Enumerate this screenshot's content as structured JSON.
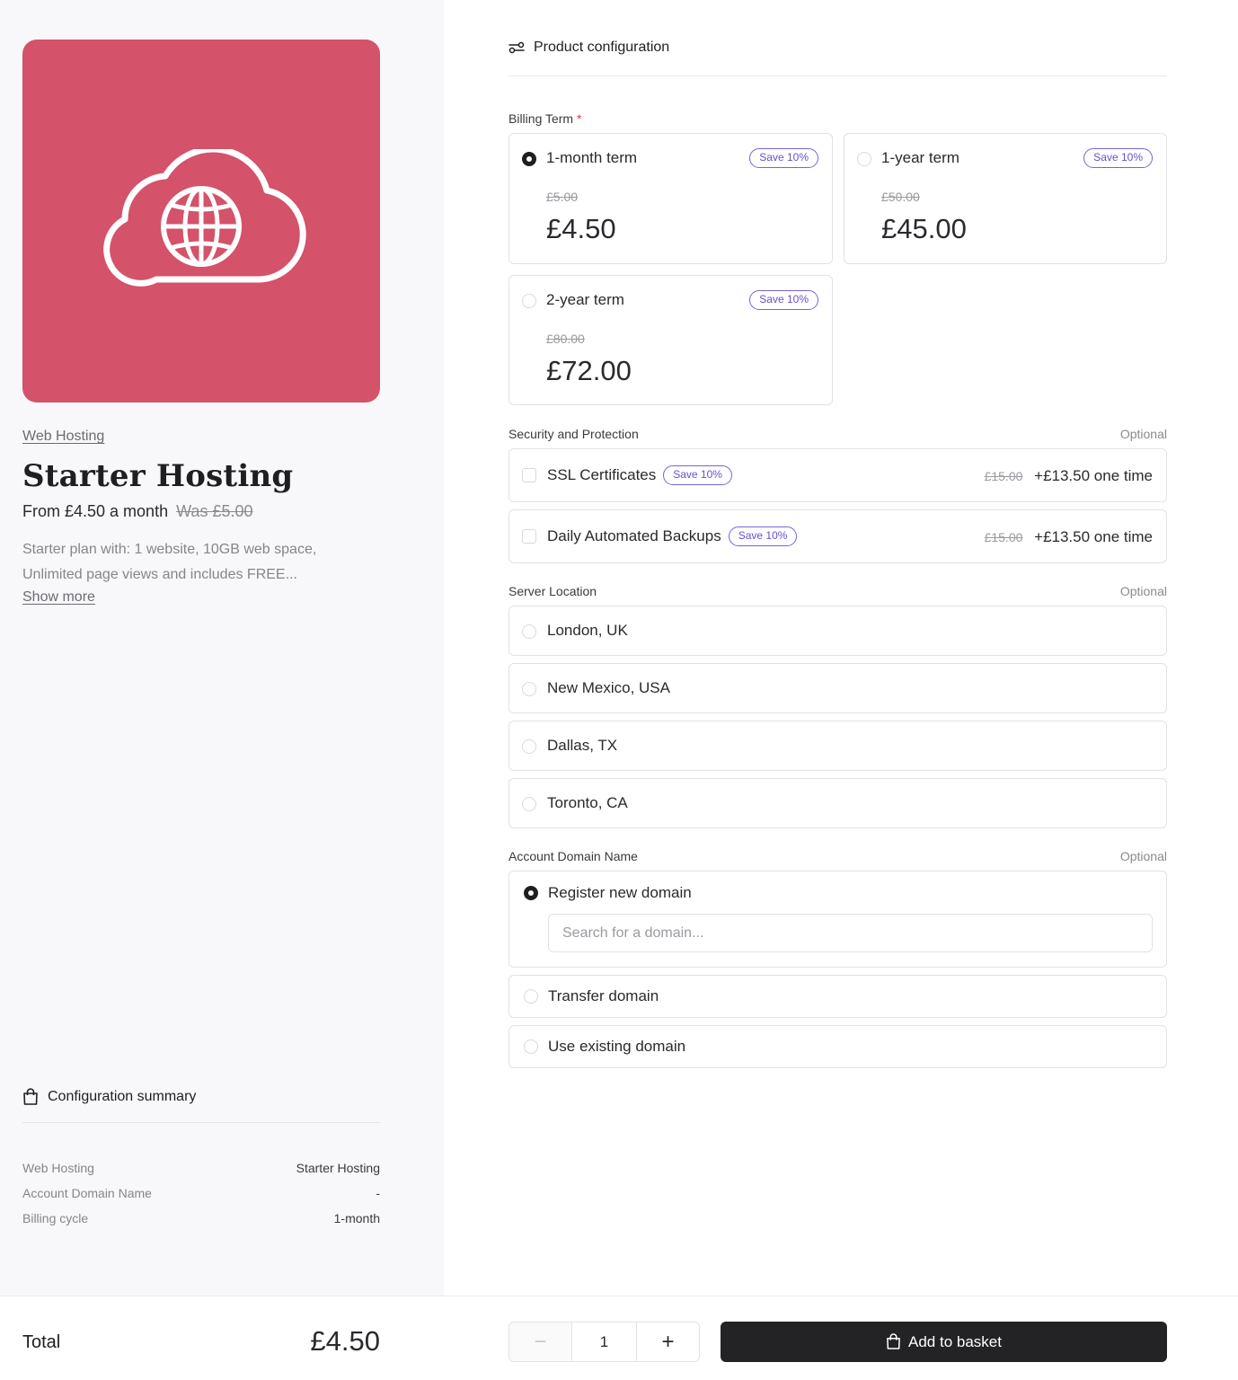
{
  "product": {
    "category": "Web Hosting",
    "title": "Starter Hosting",
    "from_text": "From £4.50 a month",
    "was_text": "Was £5.00",
    "description": "Starter plan with: 1 website, 10GB web space, Unlimited page views and includes FREE...",
    "show_more": "Show more",
    "hero_color": "#d4526a",
    "hero_icon": "cloud-globe-icon"
  },
  "summary": {
    "title": "Configuration summary",
    "rows": [
      {
        "key": "Web Hosting",
        "value": "Starter Hosting"
      },
      {
        "key": "Account Domain Name",
        "value": "-"
      },
      {
        "key": "Billing cycle",
        "value": "1-month"
      }
    ]
  },
  "config": {
    "title": "Product configuration",
    "billing": {
      "label": "Billing Term",
      "required_mark": "*",
      "terms": [
        {
          "name": "1-month term",
          "badge": "Save 10%",
          "old": "£5.00",
          "price": "£4.50",
          "selected": true
        },
        {
          "name": "1-year term",
          "badge": "Save 10%",
          "old": "£50.00",
          "price": "£45.00",
          "selected": false
        },
        {
          "name": "2-year term",
          "badge": "Save 10%",
          "old": "£80.00",
          "price": "£72.00",
          "selected": false
        }
      ]
    },
    "security": {
      "label": "Security and Protection",
      "optional": "Optional",
      "items": [
        {
          "name": "SSL Certificates",
          "badge": "Save 10%",
          "old": "£15.00",
          "price": "+£13.50 one time"
        },
        {
          "name": "Daily Automated Backups",
          "badge": "Save 10%",
          "old": "£15.00",
          "price": "+£13.50 one time"
        }
      ]
    },
    "location": {
      "label": "Server Location",
      "optional": "Optional",
      "items": [
        "London, UK",
        "New Mexico, USA",
        "Dallas, TX",
        "Toronto, CA"
      ]
    },
    "domain": {
      "label": "Account Domain Name",
      "optional": "Optional",
      "register": "Register new domain",
      "search_placeholder": "Search for a domain...",
      "transfer": "Transfer domain",
      "existing": "Use existing domain"
    }
  },
  "footer": {
    "total_label": "Total",
    "total_value": "£4.50",
    "quantity": "1",
    "minus": "−",
    "plus": "+",
    "add_label": "Add to basket",
    "button_color": "#232325"
  },
  "accent": "#6a4fd0"
}
